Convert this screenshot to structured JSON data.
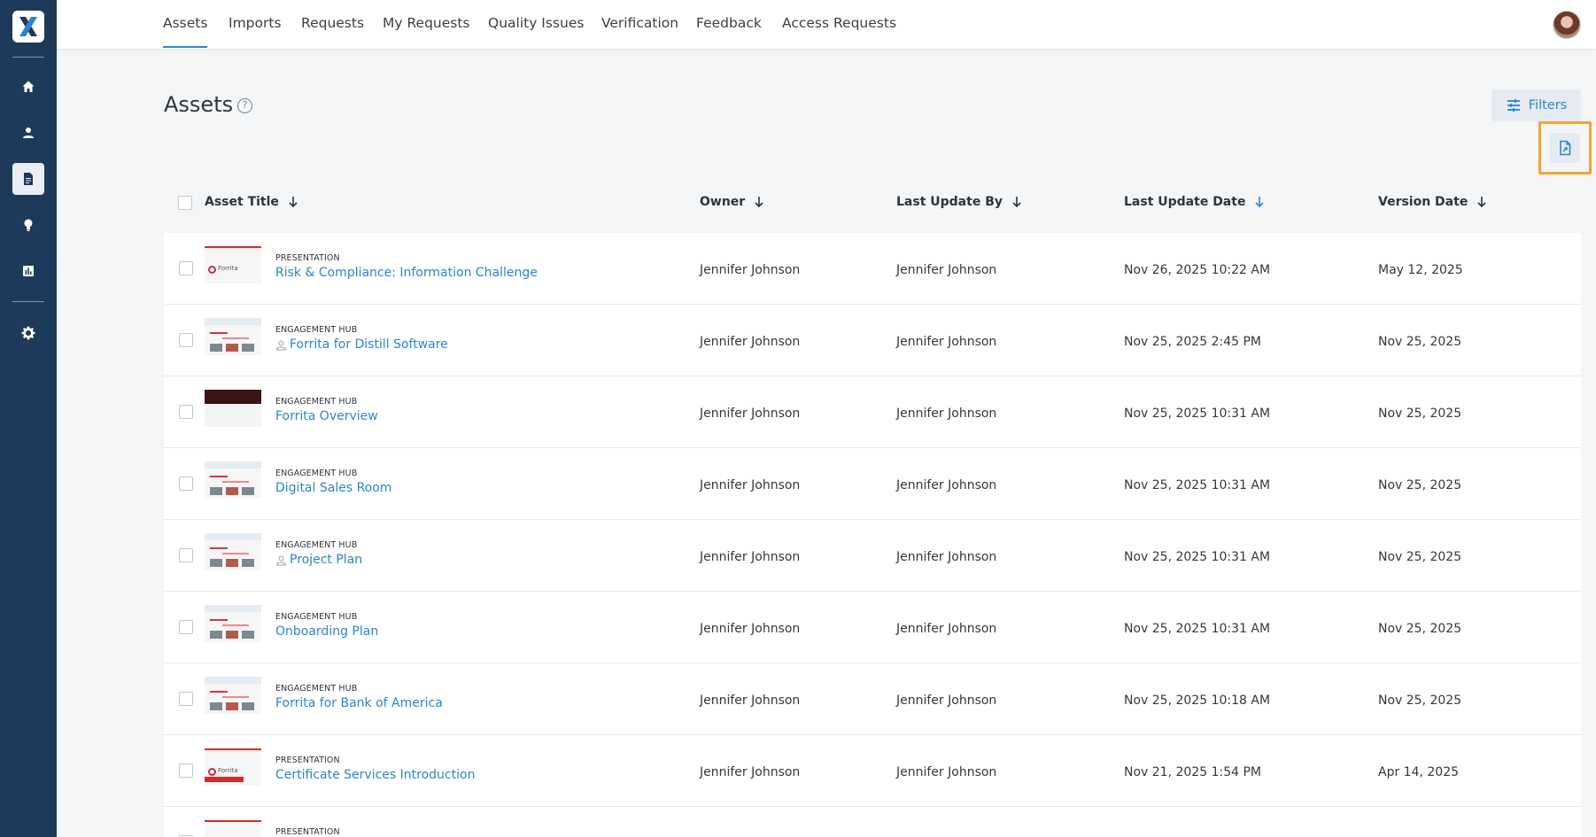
{
  "nav": {
    "tabs": [
      "Assets",
      "Imports",
      "Requests",
      "My Requests",
      "Quality Issues",
      "Verification",
      "Feedback",
      "Access Requests"
    ],
    "active_tab": "Assets"
  },
  "sidebar": {
    "items": [
      {
        "icon": "home-icon"
      },
      {
        "icon": "user-icon"
      },
      {
        "icon": "assets-icon",
        "active": true
      },
      {
        "icon": "lightbulb-icon"
      },
      {
        "icon": "chart-icon"
      },
      {
        "icon": "gear-icon"
      }
    ]
  },
  "page": {
    "title": "Assets",
    "help": "?",
    "filters_label": "Filters"
  },
  "table": {
    "headers": {
      "title": "Asset Title",
      "owner": "Owner",
      "updated_by": "Last Update By",
      "updated_date": "Last Update Date",
      "version_date": "Version Date"
    },
    "rows": [
      {
        "type": "PRESENTATION",
        "title": "Risk & Compliance: Information Challenge",
        "locked": false,
        "owner": "Jennifer Johnson",
        "updated_by": "Jennifer Johnson",
        "updated_date": "Nov 26, 2025 10:22 AM",
        "version_date": "May 12, 2025",
        "thumb": "pres"
      },
      {
        "type": "ENGAGEMENT HUB",
        "title": "Forrita for Distill Software",
        "locked": true,
        "owner": "Jennifer Johnson",
        "updated_by": "Jennifer Johnson",
        "updated_date": "Nov 25, 2025 2:45 PM",
        "version_date": "Nov 25, 2025",
        "thumb": "hub"
      },
      {
        "type": "ENGAGEMENT HUB",
        "title": "Forrita Overview",
        "locked": false,
        "owner": "Jennifer Johnson",
        "updated_by": "Jennifer Johnson",
        "updated_date": "Nov 25, 2025 10:31 AM",
        "version_date": "Nov 25, 2025",
        "thumb": "dark"
      },
      {
        "type": "ENGAGEMENT HUB",
        "title": "Digital Sales Room",
        "locked": false,
        "owner": "Jennifer Johnson",
        "updated_by": "Jennifer Johnson",
        "updated_date": "Nov 25, 2025 10:31 AM",
        "version_date": "Nov 25, 2025",
        "thumb": "hub"
      },
      {
        "type": "ENGAGEMENT HUB",
        "title": "Project Plan",
        "locked": true,
        "owner": "Jennifer Johnson",
        "updated_by": "Jennifer Johnson",
        "updated_date": "Nov 25, 2025 10:31 AM",
        "version_date": "Nov 25, 2025",
        "thumb": "hub"
      },
      {
        "type": "ENGAGEMENT HUB",
        "title": "Onboarding Plan",
        "locked": false,
        "owner": "Jennifer Johnson",
        "updated_by": "Jennifer Johnson",
        "updated_date": "Nov 25, 2025 10:31 AM",
        "version_date": "Nov 25, 2025",
        "thumb": "hub"
      },
      {
        "type": "ENGAGEMENT HUB",
        "title": "Forrita for Bank of America",
        "locked": false,
        "owner": "Jennifer Johnson",
        "updated_by": "Jennifer Johnson",
        "updated_date": "Nov 25, 2025 10:18 AM",
        "version_date": "Nov 25, 2025",
        "thumb": "hub"
      },
      {
        "type": "PRESENTATION",
        "title": "Certificate Services Introduction",
        "locked": false,
        "owner": "Jennifer Johnson",
        "updated_by": "Jennifer Johnson",
        "updated_date": "Nov 21, 2025 1:54 PM",
        "version_date": "Apr 14, 2025",
        "thumb": "pres"
      },
      {
        "type": "PRESENTATION",
        "title": "",
        "locked": false,
        "owner": "",
        "updated_by": "",
        "updated_date": "",
        "version_date": "",
        "thumb": "pres"
      }
    ]
  },
  "colors": {
    "sidebar": "#1e3a5a",
    "accent": "#2d84d0",
    "highlight": "#f0a531"
  }
}
